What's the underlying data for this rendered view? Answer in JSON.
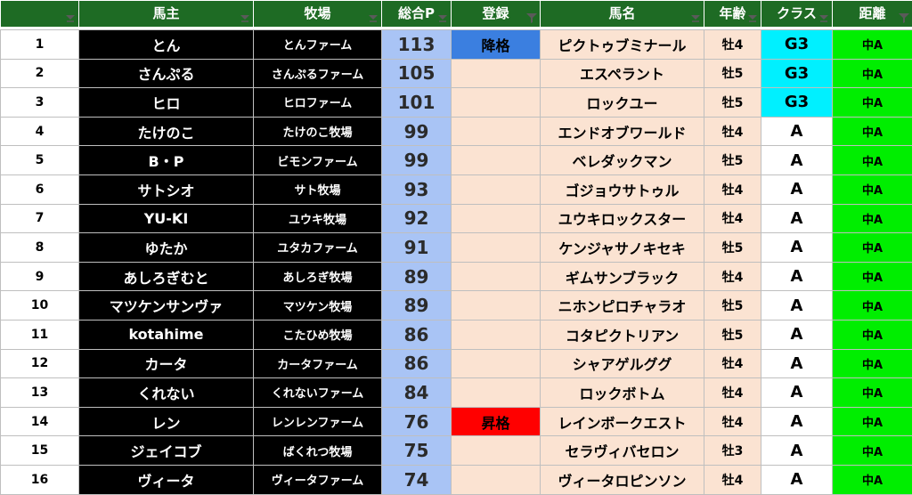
{
  "headers": {
    "num": "",
    "owner": "馬主",
    "farm": "牧場",
    "points": "総合P",
    "registration": "登録",
    "horse": "馬名",
    "age": "年齢",
    "class": "クラス",
    "distance": "距離"
  },
  "colors": {
    "header_bg": "#1e6b24",
    "owner_bg": "#000000",
    "points_bg": "#a9c4f5",
    "peach_bg": "#fbe3d2",
    "demote_bg": "#3b7fe0",
    "promote_bg": "#ff0000",
    "g3_bg": "#00f0ff",
    "distance_bg": "#00ee00"
  },
  "rows": [
    {
      "num": "1",
      "owner": "とん",
      "farm": "とんファーム",
      "points": "113",
      "reg": "降格",
      "reg_type": "demote",
      "horse": "ピクトゥブミナール",
      "age": "牡4",
      "class": "G3",
      "dist": "中A"
    },
    {
      "num": "2",
      "owner": "さんぷる",
      "farm": "さんぷるファーム",
      "points": "105",
      "reg": "",
      "reg_type": "",
      "horse": "エスペラント",
      "age": "牡5",
      "class": "G3",
      "dist": "中A"
    },
    {
      "num": "3",
      "owner": "ヒロ",
      "farm": "ヒロファーム",
      "points": "101",
      "reg": "",
      "reg_type": "",
      "horse": "ロックユー",
      "age": "牡5",
      "class": "G3",
      "dist": "中A"
    },
    {
      "num": "4",
      "owner": "たけのこ",
      "farm": "たけのこ牧場",
      "points": "99",
      "reg": "",
      "reg_type": "",
      "horse": "エンドオブワールド",
      "age": "牡4",
      "class": "A",
      "dist": "中A"
    },
    {
      "num": "5",
      "owner": "B・P",
      "farm": "ビモンファーム",
      "points": "99",
      "reg": "",
      "reg_type": "",
      "horse": "ベレダックマン",
      "age": "牡5",
      "class": "A",
      "dist": "中A"
    },
    {
      "num": "6",
      "owner": "サトシオ",
      "farm": "サト牧場",
      "points": "93",
      "reg": "",
      "reg_type": "",
      "horse": "ゴジョウサトゥル",
      "age": "牡4",
      "class": "A",
      "dist": "中A"
    },
    {
      "num": "7",
      "owner": "YU-KI",
      "farm": "ユウキ牧場",
      "points": "92",
      "reg": "",
      "reg_type": "",
      "horse": "ユウキロックスター",
      "age": "牡4",
      "class": "A",
      "dist": "中A"
    },
    {
      "num": "8",
      "owner": "ゆたか",
      "farm": "ユタカファーム",
      "points": "91",
      "reg": "",
      "reg_type": "",
      "horse": "ケンジャサノキセキ",
      "age": "牡5",
      "class": "A",
      "dist": "中A"
    },
    {
      "num": "9",
      "owner": "あしろぎむと",
      "farm": "あしろぎ牧場",
      "points": "89",
      "reg": "",
      "reg_type": "",
      "horse": "ギムサンブラック",
      "age": "牡4",
      "class": "A",
      "dist": "中A"
    },
    {
      "num": "10",
      "owner": "マツケンサンヴァ",
      "farm": "マツケン牧場",
      "points": "89",
      "reg": "",
      "reg_type": "",
      "horse": "ニホンピロチャラオ",
      "age": "牡5",
      "class": "A",
      "dist": "中A"
    },
    {
      "num": "11",
      "owner": "kotahime",
      "farm": "こたひめ牧場",
      "points": "86",
      "reg": "",
      "reg_type": "",
      "horse": "コタピクトリアン",
      "age": "牡5",
      "class": "A",
      "dist": "中A"
    },
    {
      "num": "12",
      "owner": "カータ",
      "farm": "カータファーム",
      "points": "86",
      "reg": "",
      "reg_type": "",
      "horse": "シャアゲルググ",
      "age": "牡4",
      "class": "A",
      "dist": "中A"
    },
    {
      "num": "13",
      "owner": "くれない",
      "farm": "くれないファーム",
      "points": "84",
      "reg": "",
      "reg_type": "",
      "horse": "ロックボトム",
      "age": "牡4",
      "class": "A",
      "dist": "中A"
    },
    {
      "num": "14",
      "owner": "レン",
      "farm": "レンレンファーム",
      "points": "76",
      "reg": "昇格",
      "reg_type": "promote",
      "horse": "レインボークエスト",
      "age": "牡4",
      "class": "A",
      "dist": "中A"
    },
    {
      "num": "15",
      "owner": "ジェイコブ",
      "farm": "ばくれつ牧場",
      "points": "75",
      "reg": "",
      "reg_type": "",
      "horse": "セラヴィバセロン",
      "age": "牡3",
      "class": "A",
      "dist": "中A"
    },
    {
      "num": "16",
      "owner": "ヴィータ",
      "farm": "ヴィータファーム",
      "points": "74",
      "reg": "",
      "reg_type": "",
      "horse": "ヴィータロピンソン",
      "age": "牡4",
      "class": "A",
      "dist": "中A"
    }
  ]
}
